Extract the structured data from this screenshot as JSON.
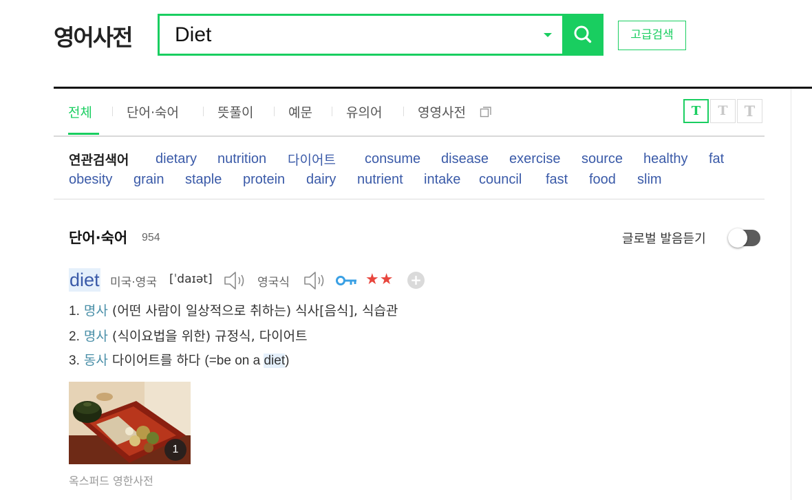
{
  "header": {
    "logo": "영어사전",
    "search": {
      "value": "Diet"
    },
    "advanced_label": "고급검색"
  },
  "tabs": [
    {
      "label": "전체",
      "active": true
    },
    {
      "label": "단어·숙어"
    },
    {
      "label": "뜻풀이"
    },
    {
      "label": "예문"
    },
    {
      "label": "유의어"
    },
    {
      "label": "영영사전"
    }
  ],
  "text_size_buttons": [
    "T",
    "T",
    "T"
  ],
  "related": {
    "title": "연관검색어",
    "words": [
      "dietary",
      "nutrition",
      "다이어트",
      "consume",
      "disease",
      "exercise",
      "source",
      "healthy",
      "fat",
      "obesity",
      "grain",
      "staple",
      "protein",
      "dairy",
      "nutrient",
      "intake",
      "council",
      "fast",
      "food",
      "slim"
    ]
  },
  "section": {
    "title": "단어·숙어",
    "count": "954",
    "global_pronounce_label": "글로벌 발음듣기",
    "global_pronounce_on": false
  },
  "entry": {
    "word": "diet",
    "pron_us_uk_label": "미국·영국",
    "phonetic": "[ˈdaɪət]",
    "pron_uk_label": "영국식",
    "stars": "★★",
    "definitions": [
      {
        "num": "1.",
        "pos": "명사",
        "text": "(어떤 사람이 일상적으로 취하는) 식사[음식], 식습관"
      },
      {
        "num": "2.",
        "pos": "명사",
        "text": "(식이요법을 위한) 규정식, 다이어트"
      },
      {
        "num": "3.",
        "pos": "동사",
        "text_pre": "다이어트를 하다 ",
        "text_paren_open": "(=be on a ",
        "text_highlight": "diet",
        "text_paren_close": ")"
      }
    ],
    "image_count": "1",
    "source": "옥스퍼드 영한사전"
  },
  "colors": {
    "accent": "#19ce60",
    "link": "#3a5aa8",
    "pos": "#4a8fa8",
    "star": "#e8463d"
  }
}
